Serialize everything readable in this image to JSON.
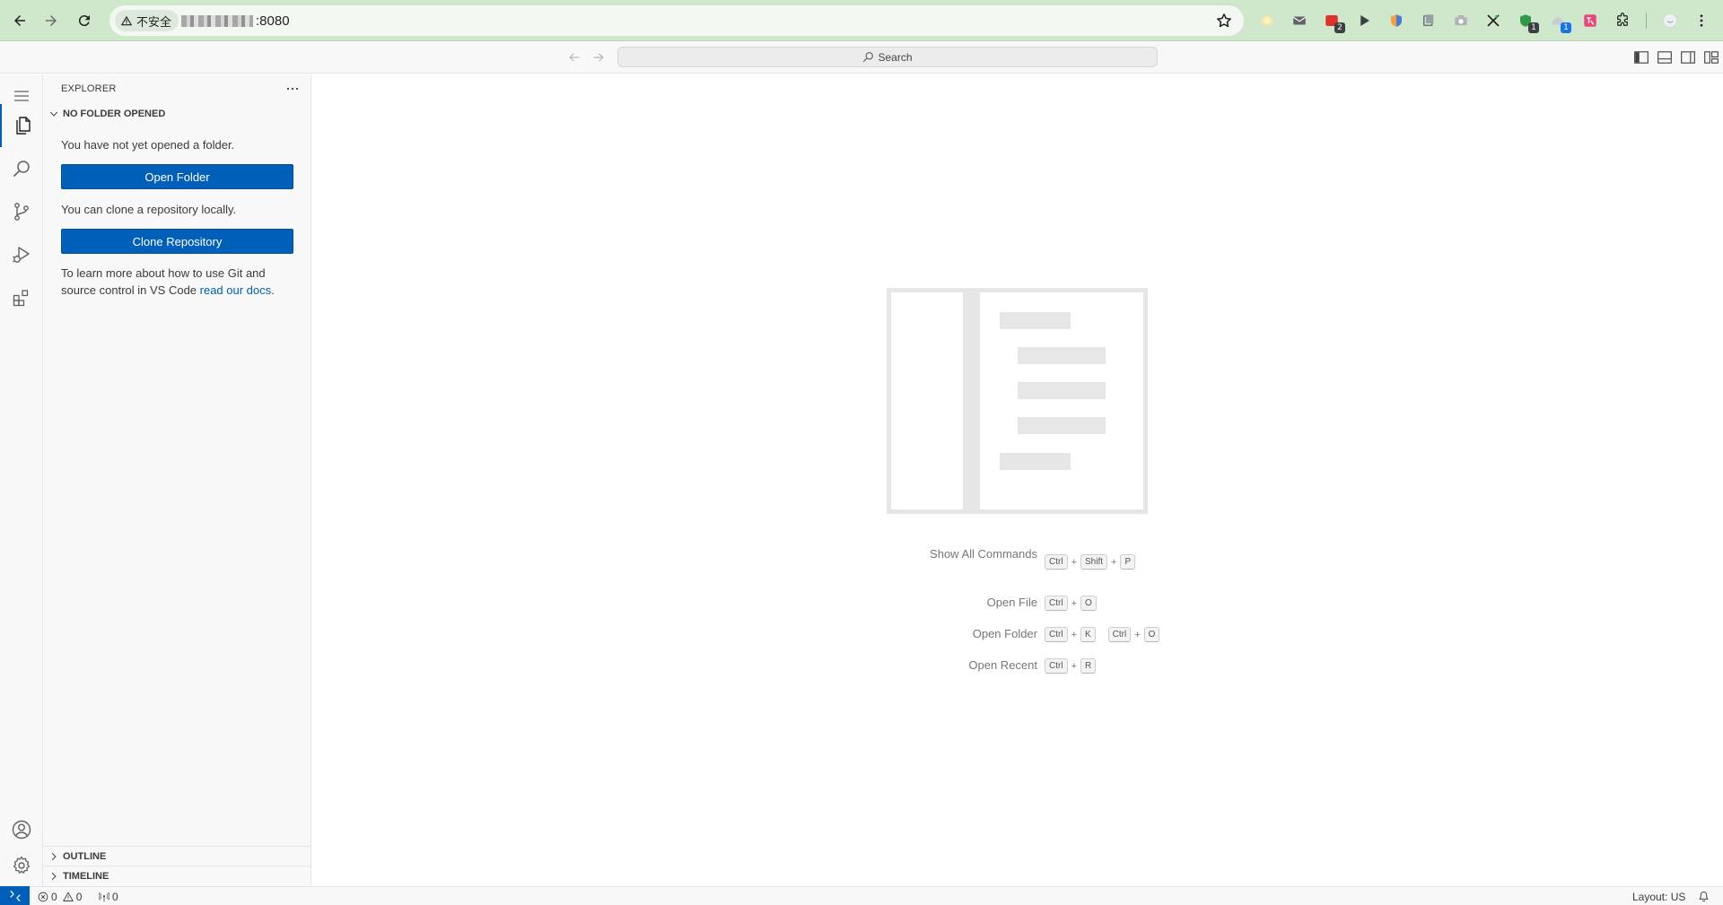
{
  "browser": {
    "insecure_label": "不安全",
    "url_port": ":8080",
    "extensions": [
      {
        "icon": "circle-extension-icon",
        "badge": ""
      },
      {
        "icon": "mail-extension-icon",
        "badge": ""
      },
      {
        "icon": "red-app-extension-icon",
        "badge": "2"
      },
      {
        "icon": "play-extension-icon",
        "badge": ""
      },
      {
        "icon": "shield-extension-icon",
        "badge": ""
      },
      {
        "icon": "copy-extension-icon",
        "badge": ""
      },
      {
        "icon": "camera-extension-icon",
        "badge": ""
      },
      {
        "icon": "scissors-extension-icon",
        "badge": ""
      },
      {
        "icon": "green-shield-extension-icon",
        "badge": "1"
      },
      {
        "icon": "cloud-extension-icon",
        "badge": "1"
      },
      {
        "icon": "translate-extension-icon",
        "badge": ""
      },
      {
        "icon": "puzzle-extensions-icon",
        "badge": ""
      }
    ]
  },
  "titlebar": {
    "search_label": "Search"
  },
  "sidebar": {
    "title": "EXPLORER",
    "section_title": "NO FOLDER OPENED",
    "no_folder_text": "You have not yet opened a folder.",
    "open_folder_label": "Open Folder",
    "clone_text": "You can clone a repository locally.",
    "clone_label": "Clone Repository",
    "learn_text": "To learn more about how to use Git and source control in VS Code ",
    "learn_link": "read our docs",
    "learn_end": ".",
    "outline_label": "OUTLINE",
    "timeline_label": "TIMELINE"
  },
  "editor": {
    "shortcuts": [
      {
        "label": "Show All Commands",
        "keys": [
          [
            "Ctrl",
            "Shift",
            "P"
          ]
        ]
      },
      {
        "label": "Open File",
        "keys": [
          [
            "Ctrl",
            "O"
          ]
        ]
      },
      {
        "label": "Open Folder",
        "keys": [
          [
            "Ctrl",
            "K"
          ],
          [
            "Ctrl",
            "O"
          ]
        ]
      },
      {
        "label": "Open Recent",
        "keys": [
          [
            "Ctrl",
            "R"
          ]
        ]
      }
    ]
  },
  "statusbar": {
    "errors": "0",
    "warnings": "0",
    "ports": "0",
    "layout": "Layout: US"
  },
  "colors": {
    "accent": "#005fb8",
    "browser_bar": "#cfe8cc"
  }
}
